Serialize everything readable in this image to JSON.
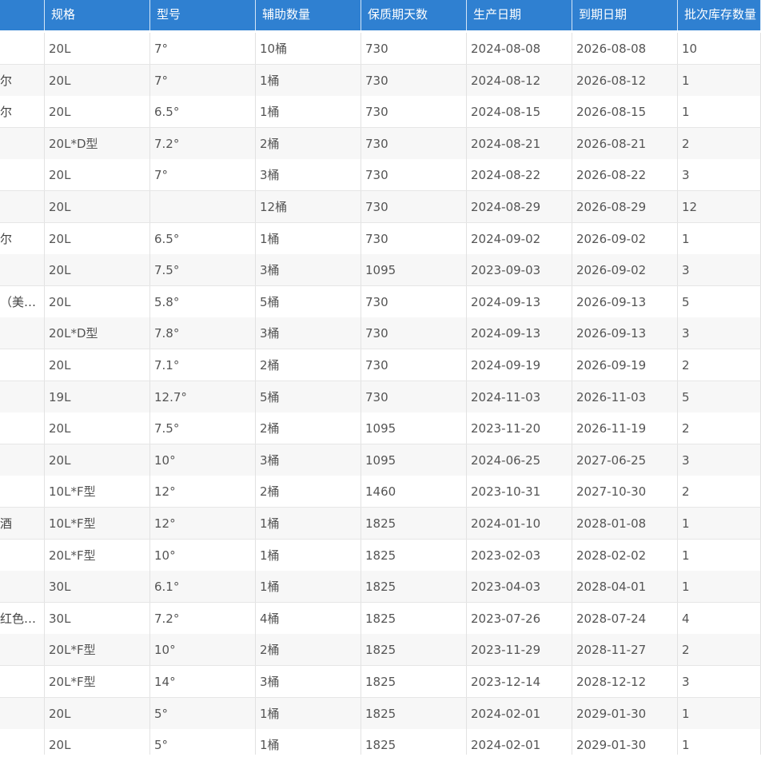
{
  "table": {
    "headers": [
      "",
      "规格",
      "型号",
      "辅助数量",
      "保质期天数",
      "生产日期",
      "到期日期",
      "批次库存数量"
    ],
    "rows": [
      [
        "",
        "20L",
        "7°",
        "10桶",
        "730",
        "2024-08-08",
        "2026-08-08",
        "10"
      ],
      [
        "尔",
        "20L",
        "7°",
        "1桶",
        "730",
        "2024-08-12",
        "2026-08-12",
        "1"
      ],
      [
        "尔",
        "20L",
        "6.5°",
        "1桶",
        "730",
        "2024-08-15",
        "2026-08-15",
        "1"
      ],
      [
        "",
        "20L*D型",
        "7.2°",
        "2桶",
        "730",
        "2024-08-21",
        "2026-08-21",
        "2"
      ],
      [
        "",
        "20L",
        "7°",
        "3桶",
        "730",
        "2024-08-22",
        "2026-08-22",
        "3"
      ],
      [
        "",
        "20L",
        "",
        "12桶",
        "730",
        "2024-08-29",
        "2026-08-29",
        "12"
      ],
      [
        "尔",
        "20L",
        "6.5°",
        "1桶",
        "730",
        "2024-09-02",
        "2026-09-02",
        "1"
      ],
      [
        "",
        "20L",
        "7.5°",
        "3桶",
        "1095",
        "2023-09-03",
        "2026-09-02",
        "3"
      ],
      [
        "（美…",
        "20L",
        "5.8°",
        "5桶",
        "730",
        "2024-09-13",
        "2026-09-13",
        "5"
      ],
      [
        "",
        "20L*D型",
        "7.8°",
        "3桶",
        "730",
        "2024-09-13",
        "2026-09-13",
        "3"
      ],
      [
        "",
        "20L",
        "7.1°",
        "2桶",
        "730",
        "2024-09-19",
        "2026-09-19",
        "2"
      ],
      [
        "",
        "19L",
        "12.7°",
        "5桶",
        "730",
        "2024-11-03",
        "2026-11-03",
        "5"
      ],
      [
        "",
        "20L",
        "7.5°",
        "2桶",
        "1095",
        "2023-11-20",
        "2026-11-19",
        "2"
      ],
      [
        "",
        "20L",
        "10°",
        "3桶",
        "1095",
        "2024-06-25",
        "2027-06-25",
        "3"
      ],
      [
        "",
        "10L*F型",
        "12°",
        "2桶",
        "1460",
        "2023-10-31",
        "2027-10-30",
        "2"
      ],
      [
        "酒",
        "10L*F型",
        "12°",
        "1桶",
        "1825",
        "2024-01-10",
        "2028-01-08",
        "1"
      ],
      [
        "",
        "20L*F型",
        "10°",
        "1桶",
        "1825",
        "2023-02-03",
        "2028-02-02",
        "1"
      ],
      [
        "",
        "30L",
        "6.1°",
        "1桶",
        "1825",
        "2023-04-03",
        "2028-04-01",
        "1"
      ],
      [
        "红色…",
        "30L",
        "7.2°",
        "4桶",
        "1825",
        "2023-07-26",
        "2028-07-24",
        "4"
      ],
      [
        "",
        "20L*F型",
        "10°",
        "2桶",
        "1825",
        "2023-11-29",
        "2028-11-27",
        "2"
      ],
      [
        "",
        "20L*F型",
        "14°",
        "3桶",
        "1825",
        "2023-12-14",
        "2028-12-12",
        "3"
      ],
      [
        "",
        "20L",
        "5°",
        "1桶",
        "1825",
        "2024-02-01",
        "2029-01-30",
        "1"
      ],
      [
        "",
        "20L",
        "5°",
        "1桶",
        "1825",
        "2024-02-01",
        "2029-01-30",
        "1"
      ]
    ]
  },
  "colors": {
    "header_bg": "#2f80d1",
    "header_text": "#ffffff",
    "row_alt_bg": "#f7f7f7",
    "cell_text": "#555555"
  }
}
